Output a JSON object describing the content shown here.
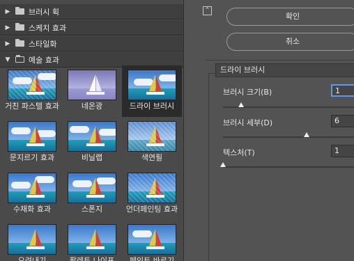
{
  "categories": [
    {
      "label": "브러시 획",
      "state": "collapsed"
    },
    {
      "label": "스케치 효과",
      "state": "collapsed"
    },
    {
      "label": "스타일화",
      "state": "collapsed"
    },
    {
      "label": "예술 효과",
      "state": "expanded"
    }
  ],
  "filters": [
    {
      "label": "거친 파스텔 효과"
    },
    {
      "label": "네온광"
    },
    {
      "label": "드라이 브러시",
      "selected": true
    },
    {
      "label": "문지르기 효과"
    },
    {
      "label": "비닐랩"
    },
    {
      "label": "색연필"
    },
    {
      "label": "수채화 효과"
    },
    {
      "label": "스폰지"
    },
    {
      "label": "언더페인팅 효과"
    },
    {
      "label": "오려내기"
    },
    {
      "label": "팔레트 나이프"
    },
    {
      "label": "페인트 바르기"
    }
  ],
  "right": {
    "collapse_icon": "double-chevron-up-icon",
    "ok_label": "확인",
    "cancel_label": "취소",
    "filter_select": "드라이 브러시",
    "params": [
      {
        "label": "브러시 크기(B)",
        "value": "1",
        "fraction": 0.13
      },
      {
        "label": "브러시 세부(D)",
        "value": "6",
        "fraction": 0.6
      },
      {
        "label": "텍스처(T)",
        "value": "1",
        "fraction": 0.0
      }
    ]
  },
  "colors": {
    "panel": "#535353",
    "accent": "#5a9ce8"
  }
}
